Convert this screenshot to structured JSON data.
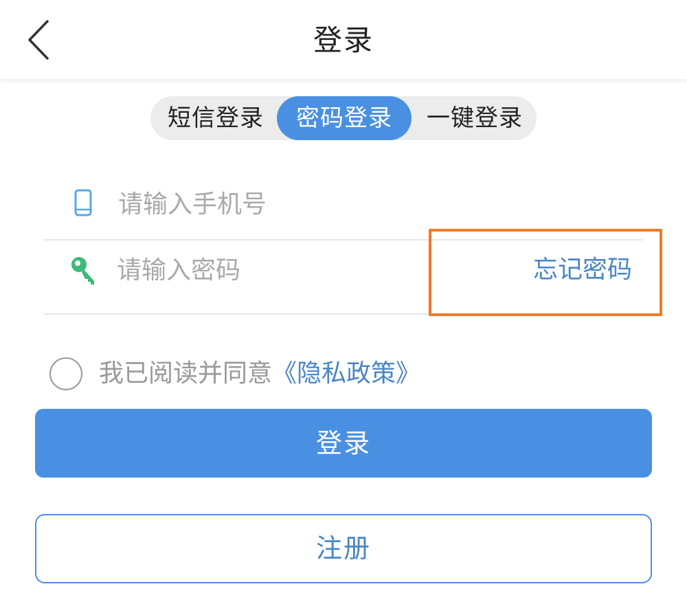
{
  "header": {
    "title": "登录"
  },
  "tabs": [
    {
      "label": "短信登录",
      "active": false
    },
    {
      "label": "密码登录",
      "active": true
    },
    {
      "label": "一键登录",
      "active": false
    }
  ],
  "form": {
    "phone_placeholder": "请输入手机号",
    "phone_value": "",
    "password_placeholder": "请输入密码",
    "password_value": "",
    "forgot_label": "忘记密码"
  },
  "agreement": {
    "checked": false,
    "text": "我已阅读并同意",
    "link": "《隐私政策》"
  },
  "buttons": {
    "login": "登录",
    "register": "注册"
  },
  "colors": {
    "accent": "#4a90e2",
    "link": "#4a86c8",
    "highlight_box": "#f27a24",
    "phone_icon": "#5aa8e6",
    "key_icon": "#3cba78"
  },
  "icons": {
    "back": "chevron-left-icon",
    "phone": "phone-icon",
    "key": "key-icon"
  }
}
